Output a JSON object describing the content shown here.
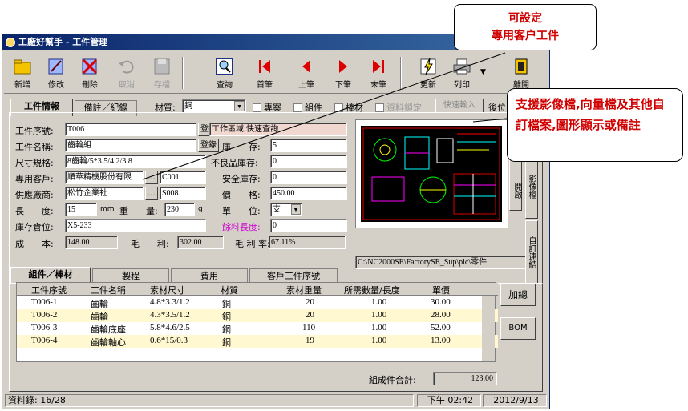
{
  "window": {
    "title": "工廠好幫手 - 工件管理"
  },
  "toolbar": {
    "new": "新增",
    "edit": "修改",
    "delete": "刪除",
    "cancel": "取消",
    "save": "存檔",
    "query": "查詢",
    "first": "首筆",
    "prev": "上筆",
    "next": "下筆",
    "last": "末筆",
    "update": "更新",
    "print": "列印",
    "exit": "離開"
  },
  "tabs": {
    "info": "工件情報",
    "notes": "備註／紀錄"
  },
  "topbar": {
    "material_label": "材質:",
    "material_value": "銅",
    "chk_dedicated": "專案",
    "chk_assembly": "組件",
    "chk_bar": "棒材",
    "chk_locked": "資料鎖定",
    "quick_input": "快速輸入",
    "auto": "後位"
  },
  "form": {
    "part_no_label": "工件序號:",
    "part_no": "T006",
    "part_name_label": "工件名稱:",
    "part_name": "齒輪組",
    "size_label": "尺寸規格:",
    "size": "8齒輪/5*3.5/4.2/3.8",
    "customer_label": "專用客戶:",
    "customer": "順華精機股份有限",
    "customer_code": "C001",
    "supplier_label": "供應廠商:",
    "supplier": "松竹企業社",
    "supplier_code": "S008",
    "length_label": "長　　度:",
    "length": "15",
    "length_unit": "mm",
    "weight_label": "重　　量:",
    "weight": "230",
    "weight_unit": "g",
    "location_label": "庫存倉位:",
    "location": "X5-233",
    "cost_label": "成　　本:",
    "cost": "148.00",
    "gross_label": "毛　　利:",
    "gross": "302.00",
    "margin_label": "毛 利 率:",
    "margin": "67.11%",
    "reg_btn": "登錄",
    "ellipsis": "...",
    "quick_query": "工作區域,快速查詢",
    "stock_label": "庫　　存:",
    "stock": "5",
    "defect_label": "不良品庫存:",
    "defect": "0",
    "safety_label": "安全庫存:",
    "safety": "0",
    "price_label": "價　　格:",
    "price": "450.00",
    "unit_label": "單　　位:",
    "unit": "支",
    "rest_label": "餘料長度:",
    "rest": "0",
    "file_path": "C:\\NC2000SE\\FactorySE_Sup\\pic\\零件",
    "open_btn": "開啟"
  },
  "side_tabs": {
    "t1": "影像檔",
    "t2": "自訂連結"
  },
  "bottom_tabs": [
    "組件／棒材",
    "製程",
    "費用",
    "客戶工件序號"
  ],
  "grid": {
    "headers": [
      "工件序號",
      "工件名稱",
      "素材尺寸",
      "材質",
      "素材重量",
      "所需數量/長度",
      "單價"
    ],
    "rows": [
      [
        "T006-1",
        "齒輪",
        "4.8*3.3/1.2",
        "銅",
        "20",
        "1.00",
        "30.00"
      ],
      [
        "T006-2",
        "齒輪",
        "4.3*3.5/1.2",
        "銅",
        "20",
        "1.00",
        "28.00"
      ],
      [
        "T006-3",
        "齒輪底座",
        "5.8*4.6/2.5",
        "銅",
        "110",
        "1.00",
        "52.00"
      ],
      [
        "T006-4",
        "齒輪軸心",
        "0.6*15/0.3",
        "銅",
        "19",
        "1.00",
        "13.00"
      ]
    ]
  },
  "side_buttons": {
    "add": "加總",
    "bom": "BOM"
  },
  "total": {
    "label": "組成件合計:",
    "value": "123.00"
  },
  "status": {
    "records": "資料錄: 16/28",
    "time": "下午 02:42",
    "date": "2012/9/13"
  },
  "callouts": {
    "top_line1": "可設定",
    "top_line2": "專用客户工件",
    "right": "支援影像檔,向量檔及其他自訂檔案,圖形顯示或備註"
  }
}
